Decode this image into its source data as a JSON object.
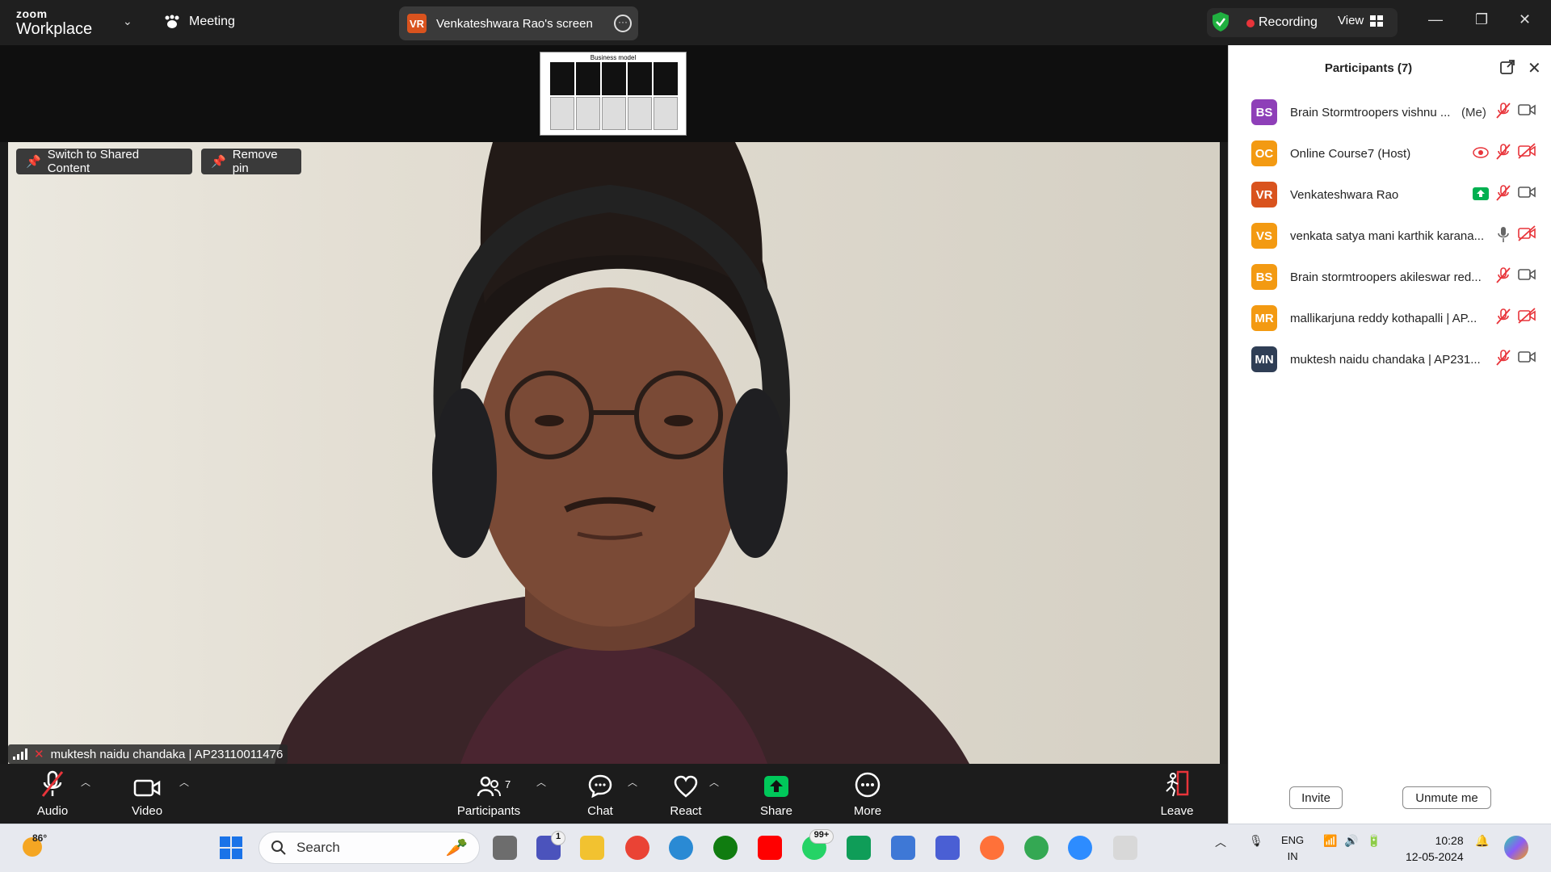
{
  "titlebar": {
    "brand_top": "zoom",
    "brand_bottom": "Workplace",
    "meeting_label": "Meeting",
    "share_initials": "VR",
    "share_label": "Venkateshwara Rao's screen",
    "recording_label": "Recording",
    "view_label": "View"
  },
  "shared_thumbnail": {
    "title": "Business model"
  },
  "video": {
    "switch_label": "Switch to Shared Content",
    "remove_pin_label": "Remove pin",
    "name_tag": "muktesh naidu chandaka | AP23110011476"
  },
  "toolbar": {
    "audio": "Audio",
    "video": "Video",
    "participants": "Participants",
    "participants_count": "7",
    "chat": "Chat",
    "react": "React",
    "share": "Share",
    "more": "More",
    "leave": "Leave",
    "share_color": "#00c85a"
  },
  "panel": {
    "title": "Participants (7)",
    "participants": [
      {
        "initials": "BS",
        "name": "Brain Stormtroopers vishnu ...",
        "tag": "(Me)",
        "color": "#8e3fb8"
      },
      {
        "initials": "OC",
        "name": "Online Course7 (Host)",
        "tag": "",
        "color": "#f39a12"
      },
      {
        "initials": "VR",
        "name": "Venkateshwara Rao",
        "tag": "",
        "color": "#d9531e"
      },
      {
        "initials": "VS",
        "name": "venkata satya mani karthik karana...",
        "tag": "",
        "color": "#f39a12"
      },
      {
        "initials": "BS",
        "name": "Brain stormtroopers akileswar red...",
        "tag": "",
        "color": "#f39a12"
      },
      {
        "initials": "MR",
        "name": "mallikarjuna reddy kothapalli | AP...",
        "tag": "",
        "color": "#f39a12"
      },
      {
        "initials": "MN",
        "name": "muktesh naidu chandaka | AP231...",
        "tag": "",
        "color": "#2f3e55"
      }
    ],
    "invite_label": "Invite",
    "unmute_label": "Unmute me"
  },
  "taskbar": {
    "temperature": "86°",
    "search_placeholder": "Search",
    "teams_badge": "1",
    "whatsapp_badge": "99+",
    "lang_top": "ENG",
    "lang_bottom": "IN",
    "time": "10:28",
    "date": "12-05-2024"
  }
}
